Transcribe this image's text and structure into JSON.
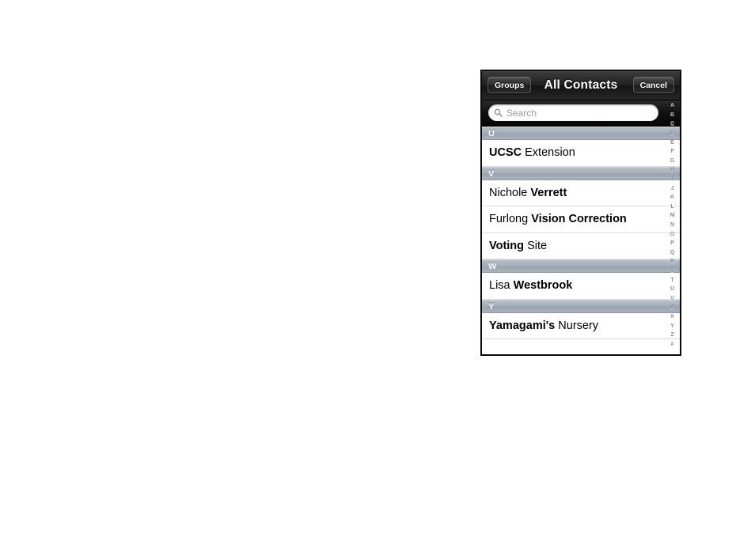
{
  "app": {
    "nav": {
      "title": "All Contacts",
      "left_button": "Groups",
      "right_button": "Cancel"
    },
    "search": {
      "placeholder": "Search",
      "value": "",
      "icon": "search-icon"
    },
    "sections": [
      {
        "letter": "U",
        "contacts": [
          {
            "first": "UCSC",
            "last": "Extension",
            "first_bold": true,
            "last_bold": false
          }
        ]
      },
      {
        "letter": "V",
        "contacts": [
          {
            "first": "Nichole",
            "last": "Verrett",
            "first_bold": false,
            "last_bold": true
          },
          {
            "first": "Furlong",
            "last": "Vision Correction",
            "first_bold": false,
            "last_bold": true
          },
          {
            "first": "Voting",
            "last": "Site",
            "first_bold": true,
            "last_bold": false
          }
        ]
      },
      {
        "letter": "W",
        "contacts": [
          {
            "first": "Lisa",
            "last": "Westbrook",
            "first_bold": false,
            "last_bold": true
          }
        ]
      },
      {
        "letter": "Y",
        "contacts": [
          {
            "first": "Yamagami's",
            "last": "Nursery",
            "first_bold": true,
            "last_bold": false
          }
        ]
      }
    ],
    "index_strip": [
      "A",
      "B",
      "C",
      "D",
      "E",
      "F",
      "G",
      "H",
      "I",
      "J",
      "K",
      "L",
      "M",
      "N",
      "O",
      "P",
      "Q",
      "R",
      "S",
      "T",
      "U",
      "V",
      "W",
      "X",
      "Y",
      "Z",
      "#"
    ],
    "colors": {
      "nav_background": "#1f1f1f",
      "section_header": "#a3acb8",
      "row_background": "#ffffff",
      "row_separator": "#dcdcdc",
      "index_text": "#8a8f96",
      "placeholder_text": "#9a9a9a"
    }
  }
}
